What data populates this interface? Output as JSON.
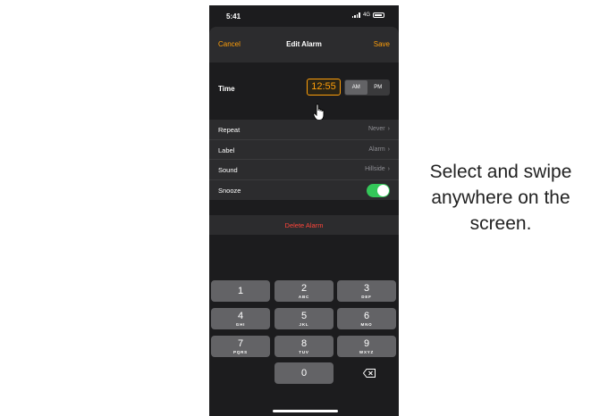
{
  "status_bar": {
    "time": "5:41",
    "network": "4G"
  },
  "nav": {
    "cancel": "Cancel",
    "title": "Edit Alarm",
    "save": "Save"
  },
  "time_row": {
    "label": "Time",
    "value": "12:55",
    "am": "AM",
    "pm": "PM",
    "selected": "AM"
  },
  "settings": [
    {
      "label": "Repeat",
      "value": "Never"
    },
    {
      "label": "Label",
      "value": "Alarm"
    },
    {
      "label": "Sound",
      "value": "Hillside"
    },
    {
      "label": "Snooze",
      "toggle": true
    }
  ],
  "delete_label": "Delete Alarm",
  "keypad": [
    {
      "num": "1",
      "letters": ""
    },
    {
      "num": "2",
      "letters": "ABC"
    },
    {
      "num": "3",
      "letters": "DEF"
    },
    {
      "num": "4",
      "letters": "GHI"
    },
    {
      "num": "5",
      "letters": "JKL"
    },
    {
      "num": "6",
      "letters": "MNO"
    },
    {
      "num": "7",
      "letters": "PQRS"
    },
    {
      "num": "8",
      "letters": "TUV"
    },
    {
      "num": "9",
      "letters": "WXYZ"
    },
    {
      "num": "0",
      "letters": ""
    }
  ],
  "instruction": "Select and swipe anywhere on the screen.",
  "colors": {
    "accent": "#ff9f0a",
    "delete": "#ff453a",
    "toggle_on": "#34c759",
    "background": "#1c1c1e"
  },
  "icons": [
    "signal-icon",
    "battery-icon",
    "hand-cursor-icon",
    "chevron-right-icon",
    "backspace-icon"
  ]
}
